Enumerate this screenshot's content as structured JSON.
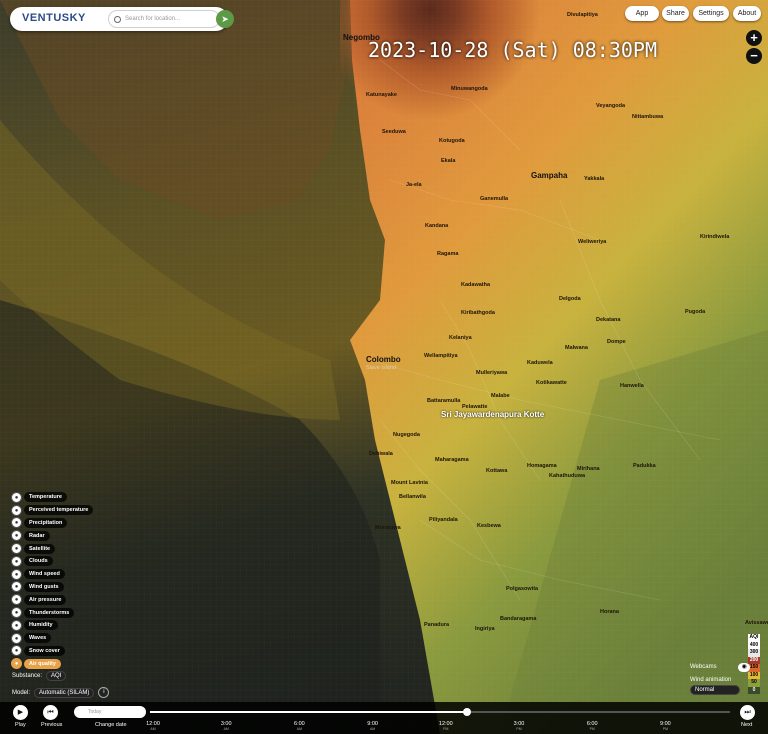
{
  "header": {
    "logo": "VENTUSKY",
    "search_placeholder": "Search for location...",
    "buttons": [
      "App",
      "Share",
      "Settings",
      "About"
    ]
  },
  "timestamp": "2023-10-28 (Sat) 08:30PM",
  "zoom": {
    "in": "+",
    "out": "−"
  },
  "cities": [
    {
      "name": "Negombo",
      "light": false
    },
    {
      "name": "Gampaha",
      "light": false
    },
    {
      "name": "Colombo",
      "light": false
    },
    {
      "name": "Slave Island",
      "light": false
    },
    {
      "name": "Sri Jayawardenapura Kotte",
      "light": true
    }
  ],
  "towns": [
    "Katunayake",
    "Seeduwa",
    "Ja-ela",
    "Kandana",
    "Ragama",
    "Minuwangoda",
    "Veyangoda",
    "Nittambuwa",
    "Divulapitiya",
    "Kotugoda",
    "Ekala",
    "Ganemulla",
    "Yakkala",
    "Kadawatha",
    "Kiribathgoda",
    "Kelaniya",
    "Wellampitiya",
    "Dompe",
    "Malabe",
    "Battaramulla",
    "Pelawatte",
    "Nugegoda",
    "Maharagama",
    "Dehiwala",
    "Mount Lavinia",
    "Homagama",
    "Kottawa",
    "Piliyandala",
    "Moratuwa",
    "Panadura",
    "Kesbewa",
    "Horana",
    "Bandaragama",
    "Ingiriya",
    "Padukka",
    "Hanwella",
    "Avissawella",
    "Pugoda",
    "Kirindiwela",
    "Weliweriya",
    "Delgoda",
    "Dekatana",
    "Malwana",
    "Kaduwela",
    "Kotikawatte",
    "Mulleriyawa",
    "Bellanwila",
    "Polgasowita",
    "Kahathuduwa",
    "Mirihana"
  ],
  "layers": [
    {
      "label": "Temperature",
      "icon": "thermometer-icon"
    },
    {
      "label": "Perceived temperature",
      "icon": "person-temp-icon"
    },
    {
      "label": "Precipitation",
      "icon": "rain-icon"
    },
    {
      "label": "Radar",
      "icon": "radar-icon"
    },
    {
      "label": "Satellite",
      "icon": "satellite-icon"
    },
    {
      "label": "Clouds",
      "icon": "cloud-icon"
    },
    {
      "label": "Wind speed",
      "icon": "wind-icon"
    },
    {
      "label": "Wind gusts",
      "icon": "gust-icon"
    },
    {
      "label": "Air pressure",
      "icon": "pressure-icon"
    },
    {
      "label": "Thunderstorms",
      "icon": "lightning-icon"
    },
    {
      "label": "Humidity",
      "icon": "droplet-icon"
    },
    {
      "label": "Waves",
      "icon": "waves-icon"
    },
    {
      "label": "Snow cover",
      "icon": "snowflake-icon"
    },
    {
      "label": "Air quality",
      "icon": "air-quality-icon",
      "active": true
    }
  ],
  "substance": {
    "label": "Substance:",
    "value": "AQI"
  },
  "model": {
    "label": "Model:",
    "value": "Automatic (SILAM)"
  },
  "legend": {
    "title": "AQI",
    "steps": [
      {
        "value": "400",
        "color": "#ffffff"
      },
      {
        "value": "300",
        "color": "#e8e8e8"
      },
      {
        "value": "200",
        "color": "#a33a2c"
      },
      {
        "value": "150",
        "color": "#d9682a"
      },
      {
        "value": "100",
        "color": "#e8b83a"
      },
      {
        "value": "50",
        "color": "#8aa03a"
      },
      {
        "value": "0",
        "color": "#3a4a2a"
      }
    ]
  },
  "webcams_label": "Webcams",
  "wind_animation": {
    "label": "Wind animation",
    "value": "Normal"
  },
  "timeline": {
    "play": "Play",
    "previous": "Previous",
    "change_date": "Change date",
    "next": "Next",
    "date_field": "Today",
    "ticks": [
      {
        "time": "12:00",
        "period": "AM"
      },
      {
        "time": "3:00",
        "period": "AM"
      },
      {
        "time": "6:00",
        "period": "AM"
      },
      {
        "time": "9:00",
        "period": "AM"
      },
      {
        "time": "12:00",
        "period": "PM"
      },
      {
        "time": "3:00",
        "period": "PM"
      },
      {
        "time": "6:00",
        "period": "PM"
      },
      {
        "time": "9:00",
        "period": "PM"
      }
    ],
    "current_fraction": 0.855
  }
}
